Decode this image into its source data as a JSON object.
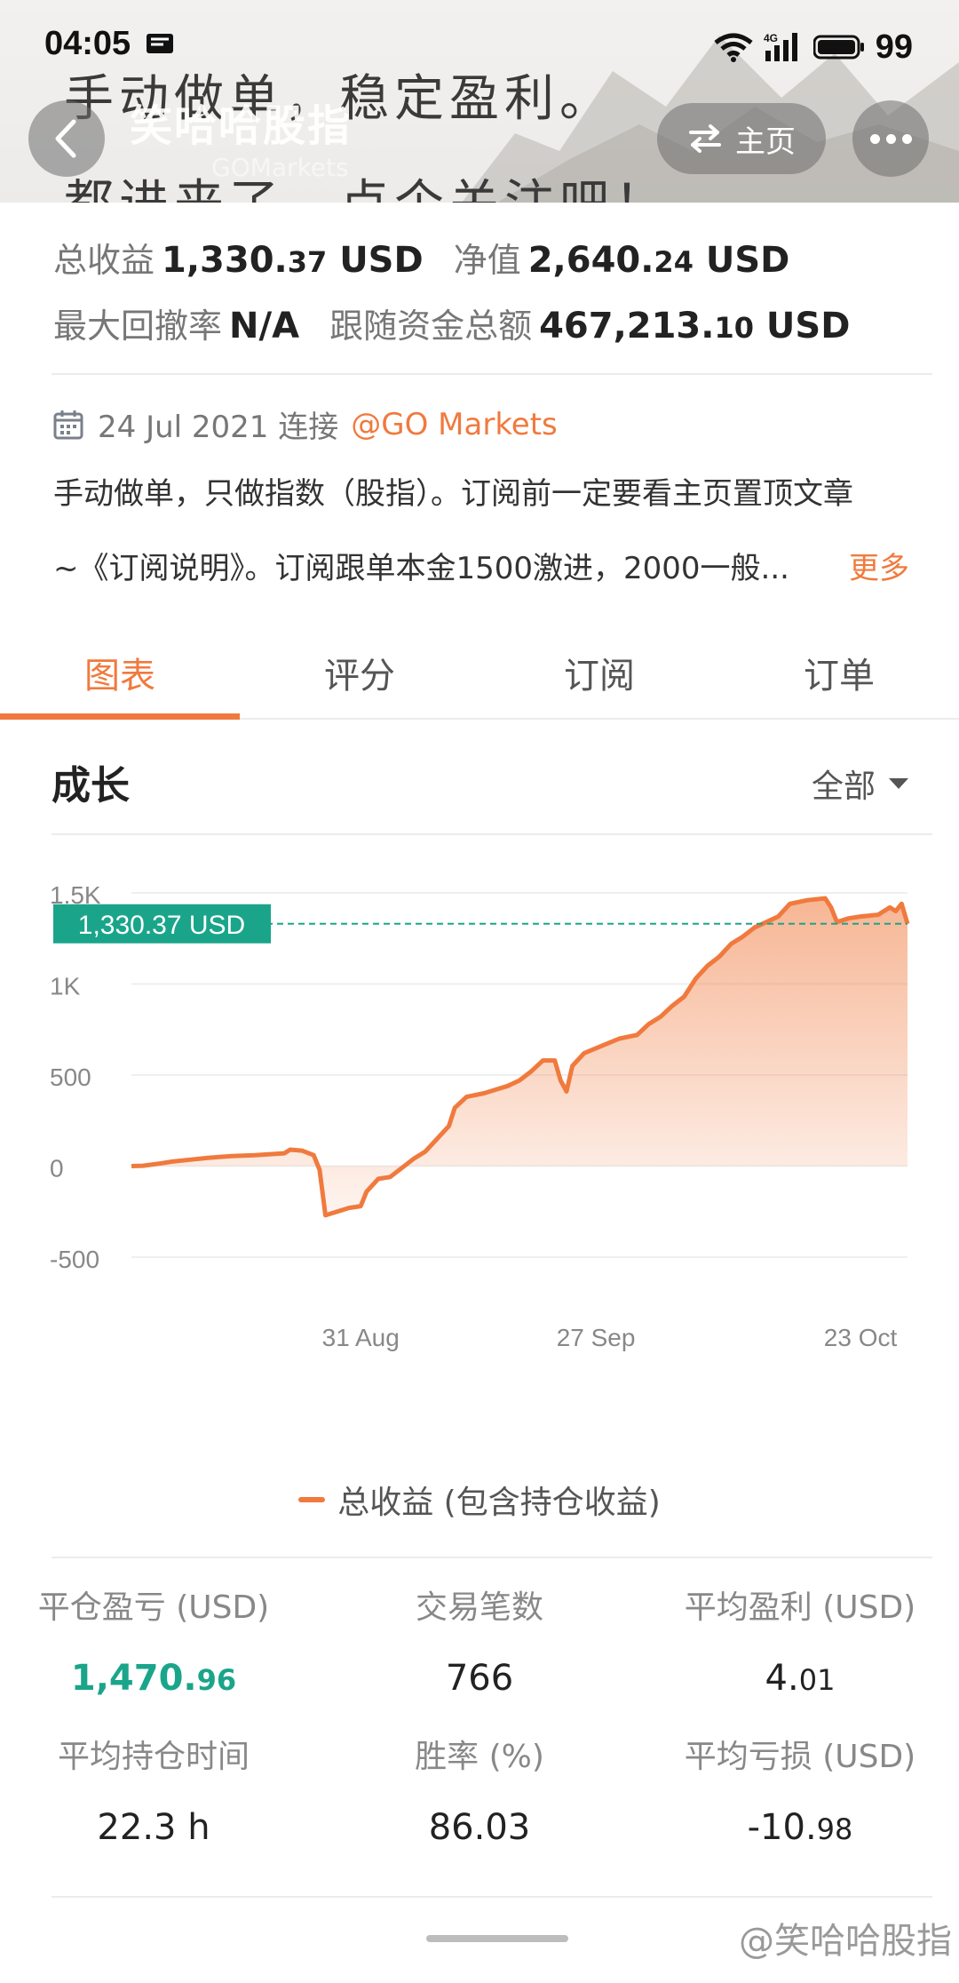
{
  "status_bar": {
    "time": "04:05",
    "battery": "99"
  },
  "header": {
    "banner_line1": "手动做单，稳定盈利。",
    "banner_line2": "都进来了，点个关注吧！",
    "name": "笑哈哈股指",
    "subtitle": "GOMarkets",
    "home_label": "主页"
  },
  "stats": {
    "total_profit_label": "总收益",
    "total_profit_int": "1,330.",
    "total_profit_dec": "37",
    "total_profit_unit": " USD",
    "equity_label": "净值",
    "equity_int": "2,640.",
    "equity_dec": "24",
    "equity_unit": " USD",
    "drawdown_label": "最大回撤率",
    "drawdown_value": "N/A",
    "follow_funds_label": "跟随资金总额",
    "follow_funds_int": "467,213.",
    "follow_funds_dec": "10",
    "follow_funds_unit": " USD"
  },
  "connection": {
    "date_text": "24 Jul 2021 连接",
    "broker": "@GO Markets"
  },
  "description": {
    "line1": "手动做单，只做指数（股指）。订阅前一定要看主页置顶文章",
    "line2": "~《订阅说明》。订阅跟单本金1500激进，2000一般...",
    "more": "更多"
  },
  "tabs": [
    "图表",
    "评分",
    "订阅",
    "订单"
  ],
  "growth": {
    "title": "成长",
    "range": "全部"
  },
  "chart_data": {
    "type": "area",
    "y_ticks": [
      "1.5K",
      "1K",
      "500",
      "0",
      "-500"
    ],
    "x_ticks": [
      "31 Aug",
      "27 Sep",
      "23 Oct"
    ],
    "ylim": [
      -500,
      1500
    ],
    "current_value_label": "1,330.37 USD",
    "current_value": 1330.37,
    "legend": "总收益 (包含持仓收益)",
    "color": "#f07a3e",
    "series": [
      {
        "name": "总收益 (包含持仓收益)",
        "points": [
          [
            0,
            0
          ],
          [
            2,
            2
          ],
          [
            5,
            15
          ],
          [
            7,
            25
          ],
          [
            10,
            35
          ],
          [
            13,
            45
          ],
          [
            17,
            55
          ],
          [
            21,
            60
          ],
          [
            26,
            70
          ],
          [
            27,
            90
          ],
          [
            29,
            85
          ],
          [
            31,
            60
          ],
          [
            32,
            -20
          ],
          [
            33,
            -270
          ],
          [
            35,
            -250
          ],
          [
            37,
            -230
          ],
          [
            39,
            -220
          ],
          [
            40,
            -140
          ],
          [
            42,
            -70
          ],
          [
            44,
            -60
          ],
          [
            46,
            -10
          ],
          [
            48,
            40
          ],
          [
            50,
            80
          ],
          [
            52,
            150
          ],
          [
            54,
            220
          ],
          [
            55,
            320
          ],
          [
            57,
            380
          ],
          [
            60,
            400
          ],
          [
            62,
            420
          ],
          [
            64,
            440
          ],
          [
            66,
            470
          ],
          [
            68,
            520
          ],
          [
            70,
            580
          ],
          [
            72,
            580
          ],
          [
            73,
            470
          ],
          [
            74,
            410
          ],
          [
            75,
            550
          ],
          [
            77,
            620
          ],
          [
            80,
            660
          ],
          [
            83,
            700
          ],
          [
            86,
            720
          ],
          [
            88,
            780
          ],
          [
            90,
            820
          ],
          [
            92,
            880
          ],
          [
            94,
            930
          ],
          [
            96,
            1030
          ],
          [
            98,
            1100
          ],
          [
            100,
            1150
          ],
          [
            102,
            1220
          ],
          [
            104,
            1260
          ],
          [
            106,
            1310
          ],
          [
            108,
            1340
          ],
          [
            110,
            1370
          ],
          [
            112,
            1440
          ],
          [
            115,
            1460
          ],
          [
            118,
            1470
          ],
          [
            119,
            1420
          ],
          [
            120,
            1340
          ],
          [
            122,
            1360
          ],
          [
            124,
            1370
          ],
          [
            127,
            1380
          ],
          [
            129,
            1420
          ],
          [
            130,
            1400
          ],
          [
            131,
            1440
          ],
          [
            132,
            1330
          ]
        ]
      }
    ],
    "x_tick_positions": [
      {
        "label": "31 Aug",
        "x": 39
      },
      {
        "label": "27 Sep",
        "x": 79
      },
      {
        "label": "23 Oct",
        "x": 124
      }
    ]
  },
  "metrics": [
    {
      "label": "平仓盈亏 (USD)",
      "int": "1,470.",
      "dec": "96",
      "green": true
    },
    {
      "label": "交易笔数",
      "int": "766",
      "dec": "",
      "green": false
    },
    {
      "label": "平均盈利 (USD)",
      "int": "4.",
      "dec": "01",
      "green": false
    },
    {
      "label": "平均持仓时间",
      "int": "22.3 h",
      "dec": "",
      "green": false
    },
    {
      "label": "胜率 (%)",
      "int": "86.03",
      "dec": "",
      "green": false
    },
    {
      "label": "平均亏损 (USD)",
      "int": "-10.",
      "dec": "98",
      "green": false
    }
  ],
  "watermark": "@笑哈哈股指"
}
